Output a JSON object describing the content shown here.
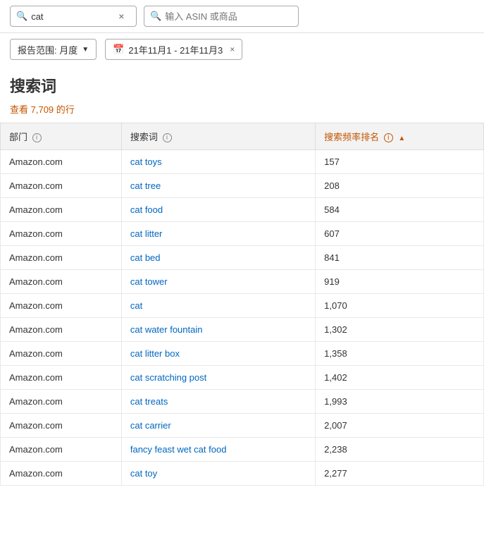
{
  "topBar": {
    "searchBox": {
      "value": "cat",
      "clearLabel": "×"
    },
    "asinBox": {
      "placeholder": "输入 ASIN 或商品",
      "searchIconLabel": "🔍"
    }
  },
  "filterRow": {
    "reportLabel": "报告范围: 月度",
    "dateRange": "21年11月1 - 21年11月3",
    "dateCloseLabel": "×",
    "calIconLabel": "📅"
  },
  "pageTitle": "搜索词",
  "rowCount": {
    "prefix": "查看 ",
    "count": "7,709",
    "suffix": " 的行"
  },
  "table": {
    "columns": [
      {
        "id": "dept",
        "label": "部门",
        "hasInfo": true,
        "sorted": false
      },
      {
        "id": "term",
        "label": "搜索词",
        "hasInfo": true,
        "sorted": false
      },
      {
        "id": "rank",
        "label": "搜索频率排名",
        "hasInfo": true,
        "sorted": true,
        "sortDir": "▲"
      }
    ],
    "rows": [
      {
        "dept": "Amazon.com",
        "term": "cat toys",
        "rank": "157"
      },
      {
        "dept": "Amazon.com",
        "term": "cat tree",
        "rank": "208"
      },
      {
        "dept": "Amazon.com",
        "term": "cat food",
        "rank": "584"
      },
      {
        "dept": "Amazon.com",
        "term": "cat litter",
        "rank": "607"
      },
      {
        "dept": "Amazon.com",
        "term": "cat bed",
        "rank": "841"
      },
      {
        "dept": "Amazon.com",
        "term": "cat tower",
        "rank": "919"
      },
      {
        "dept": "Amazon.com",
        "term": "cat",
        "rank": "1,070"
      },
      {
        "dept": "Amazon.com",
        "term": "cat water fountain",
        "rank": "1,302"
      },
      {
        "dept": "Amazon.com",
        "term": "cat litter box",
        "rank": "1,358"
      },
      {
        "dept": "Amazon.com",
        "term": "cat scratching post",
        "rank": "1,402"
      },
      {
        "dept": "Amazon.com",
        "term": "cat treats",
        "rank": "1,993"
      },
      {
        "dept": "Amazon.com",
        "term": "cat carrier",
        "rank": "2,007"
      },
      {
        "dept": "Amazon.com",
        "term": "fancy feast wet cat food",
        "rank": "2,238"
      },
      {
        "dept": "Amazon.com",
        "term": "cat toy",
        "rank": "2,277"
      }
    ]
  }
}
